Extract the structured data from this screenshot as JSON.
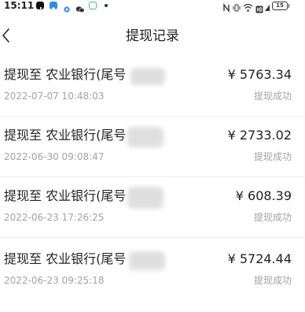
{
  "status_bar": {
    "time": "15:11",
    "battery": "15",
    "app_icons": [
      "tiktok-icon",
      "qq-icon",
      "browser-icon",
      "wechat-icon",
      "app-icon"
    ]
  },
  "header": {
    "title": "提现记录"
  },
  "records": [
    {
      "description": "提现至 农业银行(尾号",
      "amount": "¥ 5763.34",
      "time": "2022-07-07 10:48:03",
      "status": "提现成功"
    },
    {
      "description": "提现至 农业银行(尾号",
      "amount": "¥ 2733.02",
      "time": "2022-06-30 09:08:47",
      "status": "提现成功"
    },
    {
      "description": "提现至 农业银行(尾号",
      "amount": "¥ 608.39",
      "time": "2022-06-23 17:26:25",
      "status": "提现成功"
    },
    {
      "description": "提现至 农业银行(尾号",
      "amount": "¥ 5724.44",
      "time": "2022-06-23 09:25:18",
      "status": "提现成功"
    }
  ],
  "colors": {
    "text_primary": "#222222",
    "text_secondary": "#a3a3a3",
    "divider": "#ececec",
    "background": "#ffffff"
  }
}
